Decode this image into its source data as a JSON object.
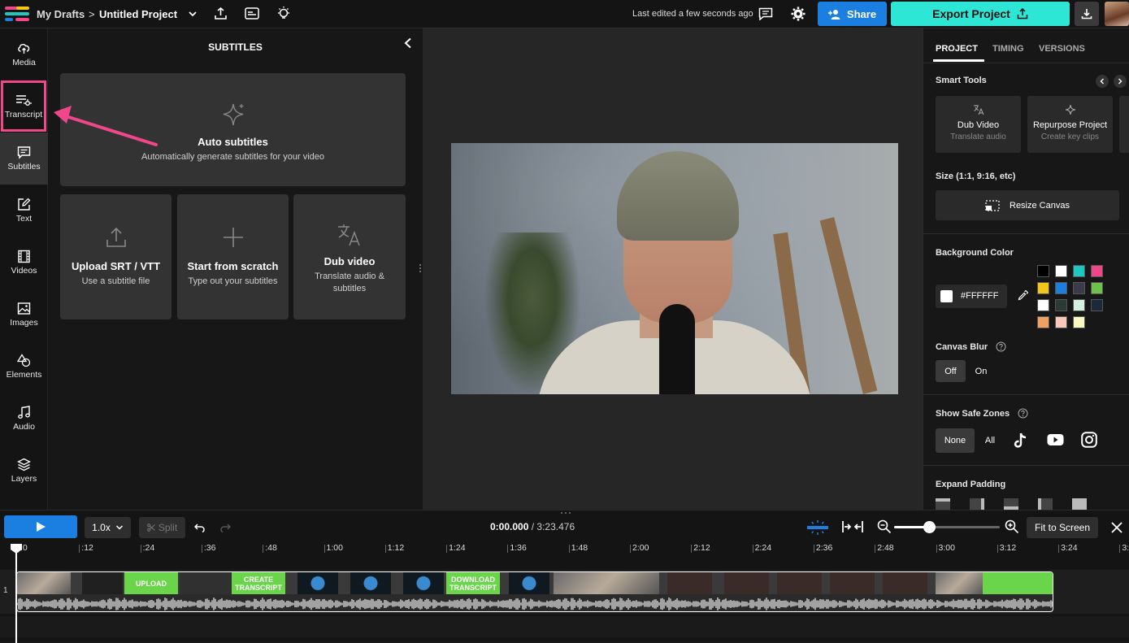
{
  "topbar": {
    "breadcrumb_root": "My Drafts",
    "breadcrumb_sep": ">",
    "project_title": "Untitled Project",
    "last_edited": "Last edited a few seconds ago",
    "share_label": "Share",
    "export_label": "Export Project"
  },
  "leftnav": {
    "items": [
      {
        "label": "Media"
      },
      {
        "label": "Transcript"
      },
      {
        "label": "Subtitles"
      },
      {
        "label": "Text"
      },
      {
        "label": "Videos"
      },
      {
        "label": "Images"
      },
      {
        "label": "Elements"
      },
      {
        "label": "Audio"
      },
      {
        "label": "Layers"
      }
    ]
  },
  "subtitles": {
    "title": "SUBTITLES",
    "auto": {
      "title": "Auto subtitles",
      "sub": "Automatically generate subtitles for your video"
    },
    "upload": {
      "title": "Upload SRT / VTT",
      "sub": "Use a subtitle file"
    },
    "scratch": {
      "title": "Start from scratch",
      "sub": "Type out your subtitles"
    },
    "dub": {
      "title": "Dub video",
      "sub1": "Translate audio &",
      "sub2": "subtitles"
    }
  },
  "right": {
    "tabs": [
      "PROJECT",
      "TIMING",
      "VERSIONS"
    ],
    "smart_tools": "Smart Tools",
    "dub_title": "Dub Video",
    "dub_sub": "Translate audio",
    "repurpose_title": "Repurpose Project",
    "repurpose_sub": "Create key clips",
    "size_label": "Size (1:1, 9:16, etc)",
    "resize_label": "Resize Canvas",
    "bg_label": "Background Color",
    "bg_hex": "#FFFFFF",
    "swatches": [
      "#000000",
      "#ffffff",
      "#1ec8c0",
      "#f0468a",
      "#f5c518",
      "#1a7fe0",
      "#3a3a4a",
      "#6cc24a",
      "#ffffff",
      "#2a3a34",
      "#d4f0e0",
      "#1a2a3a",
      "#f0a060",
      "#f8c8b8",
      "#f8f8c0"
    ],
    "blur_label": "Canvas Blur",
    "blur_off": "Off",
    "blur_on": "On",
    "safe_label": "Show Safe Zones",
    "safe_none": "None",
    "safe_all": "All",
    "padding_label": "Expand Padding"
  },
  "timeline": {
    "speed": "1.0x",
    "split": "Split",
    "current_time": "0:00.000",
    "sep": "/",
    "total_time": "3:23.476",
    "fit_label": "Fit to Screen",
    "zoom_level": 0.33,
    "track_number": "1",
    "ticks": [
      ":0",
      ":12",
      ":24",
      ":36",
      ":48",
      "1:00",
      "1:12",
      "1:24",
      "1:36",
      "1:48",
      "2:00",
      "2:12",
      "2:24",
      "2:36",
      "2:48",
      "3:00",
      "3:12",
      "3:24",
      "3:3"
    ],
    "clip_labels": {
      "upload": "UPLOAD",
      "create": "CREATE TRANSCRIPT",
      "download": "DOWNLOAD TRANSCRIPT"
    }
  },
  "colors": {
    "accent_blue": "#1a7fe0",
    "export_teal": "#2ee6d6",
    "highlight_pink": "#f0468a",
    "clip_green": "#6ad44a"
  }
}
